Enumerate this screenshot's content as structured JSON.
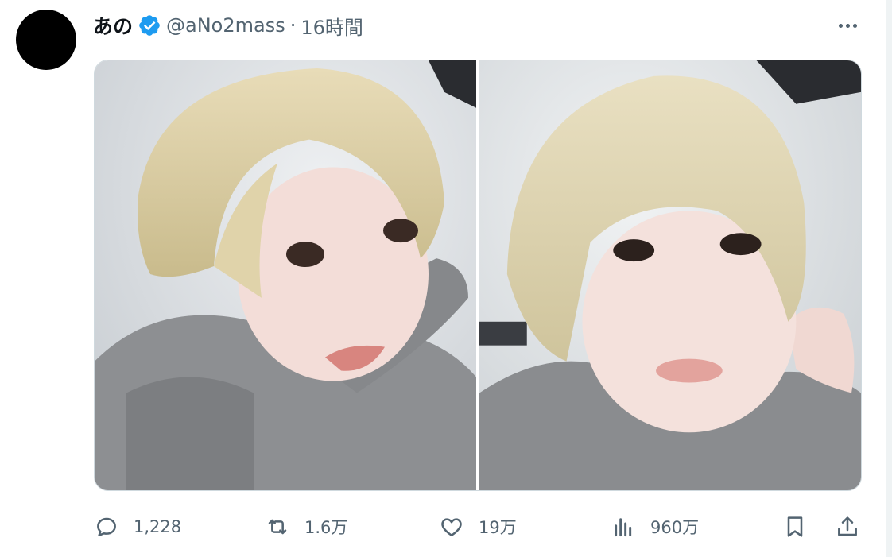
{
  "author": {
    "display_name": "あの",
    "handle": "@aNo2mass",
    "separator": "·",
    "time": "16時間",
    "verified": true
  },
  "media": {
    "count": 2
  },
  "actions": {
    "replies": "1,228",
    "reposts": "1.6万",
    "likes": "19万",
    "views": "960万"
  },
  "colors": {
    "text_primary": "#0f1419",
    "text_secondary": "#536471",
    "verified_badge": "#1d9bf0",
    "border": "#cfd9de"
  },
  "icons": {
    "more": "more-dots-icon",
    "reply": "reply-icon",
    "repost": "repost-icon",
    "like": "heart-icon",
    "views": "views-chart-icon",
    "bookmark": "bookmark-icon",
    "share": "share-icon"
  }
}
